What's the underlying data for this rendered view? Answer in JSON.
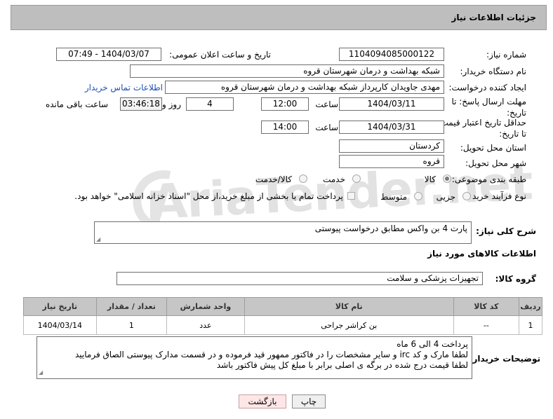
{
  "title": "جزئیات اطلاعات نیاز",
  "watermark": "AriaTender.net",
  "fields": {
    "need_number_label": "شماره نیاز:",
    "need_number": "1104094085000122",
    "announce_label": "تاریخ و ساعت اعلان عمومی:",
    "announce_value": "1404/03/07 - 07:49",
    "buyer_org_label": "نام دستگاه خریدار:",
    "buyer_org": "شبکه بهداشت و درمان شهرستان قروه",
    "creator_label": "ایجاد کننده درخواست:",
    "creator": "مهدی جاویدان کارپرداز شبکه بهداشت و درمان شهرستان قروه",
    "contact_link": "اطلاعات تماس خریدار",
    "deadline_label_1": "مهلت ارسال پاسخ: تا",
    "deadline_label_2": "تاریخ:",
    "deadline_date": "1404/03/11",
    "time_label": "ساعت",
    "deadline_time": "12:00",
    "days_value": "4",
    "days_label": "روز و",
    "remaining_value": "03:46:18",
    "remaining_label": "ساعت باقی مانده",
    "validity_label_1": "حداقل تاریخ اعتبار قیمت:",
    "validity_label_2": "تا تاریخ:",
    "validity_date": "1404/03/31",
    "validity_time": "14:00",
    "province_label": "استان محل تحویل:",
    "province": "کردستان",
    "city_label": "شهر محل تحویل:",
    "city": "قروه",
    "category_label": "طبقه بندی موضوعی:",
    "category_options": [
      "کالا",
      "خدمت",
      "کالا/خدمت"
    ],
    "process_label": "نوع فرآیند خرید :",
    "process_options": [
      "جزیی",
      "متوسط"
    ],
    "payment_text": "پرداخت تمام یا بخشی از مبلغ خرید،از محل \"اسناد خزانه اسلامی\" خواهد بود."
  },
  "description": {
    "label": "شرح کلی نیاز:",
    "value": "پارت 4 بن واکس مطابق درخواست پیوستی"
  },
  "goods_section_title": "اطلاعات کالاهای مورد نیاز",
  "goods_group": {
    "label": "گروه کالا:",
    "value": "تجهیزات پزشکی و سلامت"
  },
  "table": {
    "headers": [
      "ردیف",
      "کد کالا",
      "نام کالا",
      "واحد شمارش",
      "تعداد / مقدار",
      "تاریخ نیاز"
    ],
    "rows": [
      [
        "1",
        "--",
        "بن کراشر جراحی",
        "عدد",
        "1",
        "1404/03/14"
      ]
    ]
  },
  "buyer_notes": {
    "label": "توضیحات خریدار:",
    "lines": [
      "پرداخت 4 الی 6 ماه",
      "لطفا مارک و کد irc  و سایر مشخصات را در فاکتور ممهور قید فرموده و در قسمت مدارک پیوستی الصاق فرمایید",
      "لطفا قیمت درج شده در برگه ی اصلی برابر با مبلغ کل پیش فاکتور باشد"
    ]
  },
  "buttons": {
    "print": "چاپ",
    "back": "بازگشت"
  }
}
